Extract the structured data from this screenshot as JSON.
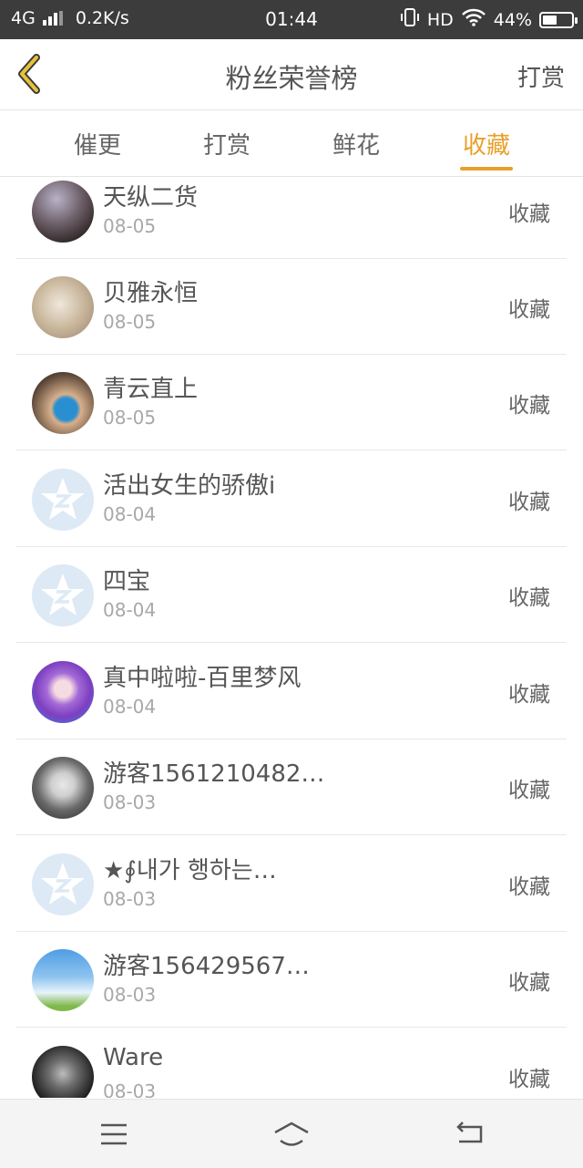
{
  "status": {
    "network": "4G",
    "speed": "0.2K/s",
    "time": "01:44",
    "hd": "HD",
    "battery": "44%"
  },
  "header": {
    "title": "粉丝荣誉榜",
    "right_action": "打赏"
  },
  "tabs": [
    {
      "label": "催更"
    },
    {
      "label": "打赏"
    },
    {
      "label": "鲜花"
    },
    {
      "label": "收藏",
      "active": true
    }
  ],
  "colors": {
    "accent": "#e8a02a"
  },
  "fans": [
    {
      "name": "天纵二货",
      "date": "08-05",
      "action": "收藏",
      "avatar": "photo-dark"
    },
    {
      "name": "贝雅永恒",
      "date": "08-05",
      "action": "收藏",
      "avatar": "anime-beige"
    },
    {
      "name": "青云直上",
      "date": "08-05",
      "action": "收藏",
      "avatar": "child-photo"
    },
    {
      "name": "活出女生的骄傲i",
      "date": "08-04",
      "action": "收藏",
      "avatar": "default-star"
    },
    {
      "name": "四宝",
      "date": "08-04",
      "action": "收藏",
      "avatar": "default-star"
    },
    {
      "name": "真中啦啦-百里梦风",
      "date": "08-04",
      "action": "收藏",
      "avatar": "anime-purple"
    },
    {
      "name": "游客1561210482…",
      "date": "08-03",
      "action": "收藏",
      "avatar": "sketch-girl"
    },
    {
      "name": "★∮내가 행하는…",
      "date": "08-03",
      "action": "收藏",
      "avatar": "default-star"
    },
    {
      "name": "游客156429567…",
      "date": "08-03",
      "action": "收藏",
      "avatar": "sky"
    },
    {
      "name": "Ware",
      "date": "08-03",
      "action": "收藏",
      "avatar": "bw-photo"
    }
  ]
}
